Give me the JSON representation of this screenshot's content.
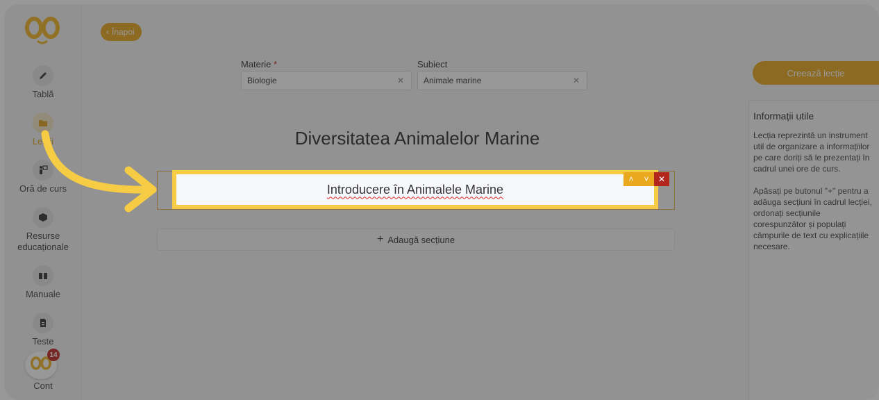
{
  "sidebar": {
    "items": [
      {
        "label": "Tablă",
        "icon": "pencil-icon"
      },
      {
        "label": "Lecții",
        "icon": "folder-icon"
      },
      {
        "label": "Oră de curs",
        "icon": "teacher-icon"
      },
      {
        "label": "Resurse educaționale",
        "icon": "box-icon"
      },
      {
        "label": "Manuale",
        "icon": "book-icon"
      },
      {
        "label": "Teste",
        "icon": "file-icon"
      }
    ],
    "account": {
      "label": "Cont",
      "badge": "14"
    }
  },
  "header": {
    "back_label": "Înapoi"
  },
  "form": {
    "subject_label": "Materie",
    "subject_required": "*",
    "subject_value": "Biologie",
    "topic_label": "Subiect",
    "topic_value": "Animale marine"
  },
  "lesson": {
    "title": "Diversitatea Animalelor Marine",
    "section_title": "Introducere în Animalele Marine",
    "add_section_label": "Adaugă secțiune"
  },
  "right": {
    "create_label": "Creează lecție",
    "info_title": "Informații utile",
    "info_p1": "Lecția reprezintă un instrument util de organizare a informațiilor pe care doriți să le prezentați în cadrul unei ore de curs.",
    "info_p2": "Apăsați pe butonul \"+\" pentru a adăuga secțiuni în cadrul lecției, ordonați secțiunile corespunzător și populați câmpurile de text cu explicațiile necesare."
  },
  "colors": {
    "accent": "#e9a81e",
    "danger": "#b3261e",
    "highlight": "#f6cc44"
  }
}
